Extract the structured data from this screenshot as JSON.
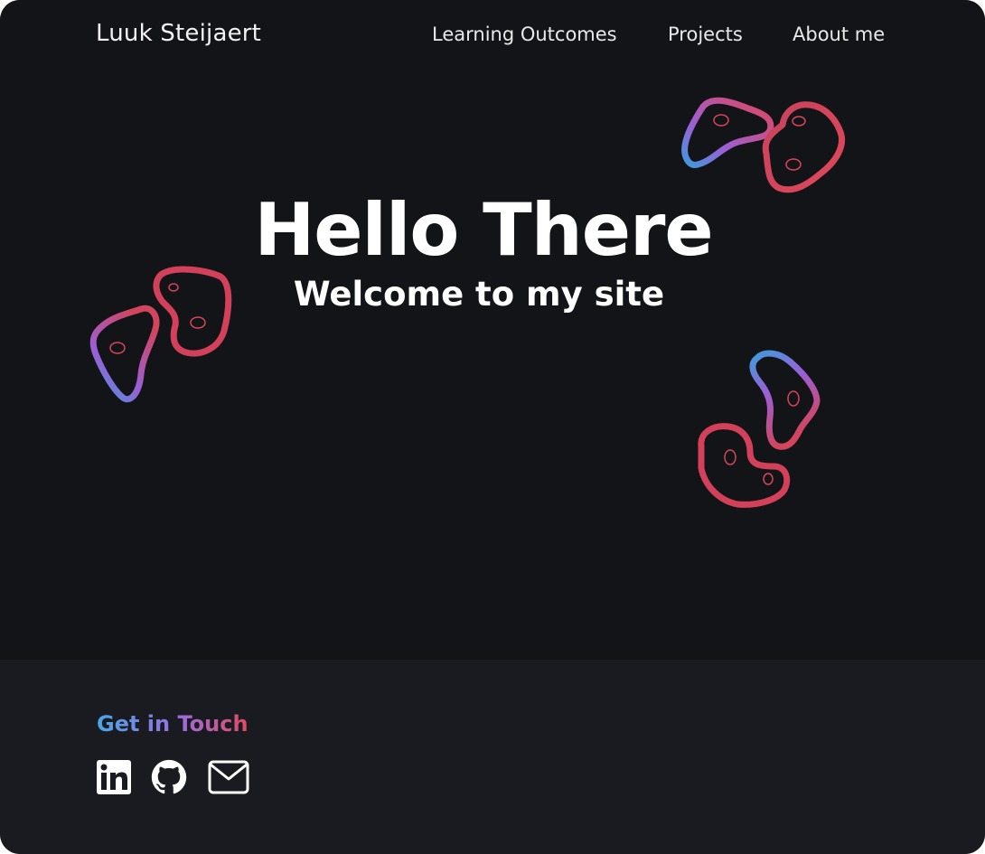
{
  "header": {
    "brand": "Luuk Steijaert",
    "nav": [
      {
        "label": "Learning Outcomes"
      },
      {
        "label": "Projects"
      },
      {
        "label": "About me"
      }
    ]
  },
  "hero": {
    "title": "Hello There",
    "subtitle": "Welcome to my site",
    "decorations": [
      "blob-pair-icon",
      "blob-pair-icon",
      "blob-pair-icon"
    ]
  },
  "footer": {
    "heading": "Get in Touch",
    "social": [
      {
        "icon": "linkedin-icon"
      },
      {
        "icon": "github-icon"
      },
      {
        "icon": "mail-icon"
      }
    ]
  },
  "colors": {
    "background": "#131418",
    "footer_background": "#1a1b20",
    "text": "#ffffff",
    "gradient_blue": "#4aa6e6",
    "gradient_purple": "#9b6de0",
    "gradient_red": "#e04b62"
  }
}
